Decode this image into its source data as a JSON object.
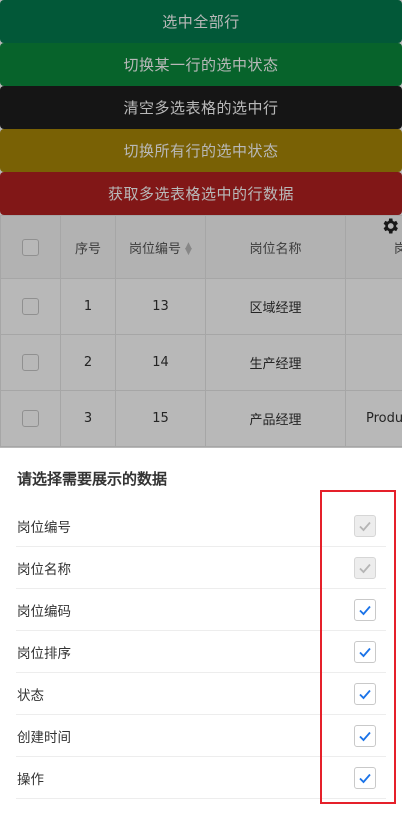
{
  "buttons": [
    {
      "label": "选中全部行",
      "color": "#037a4e"
    },
    {
      "label": "切换某一行的选中状态",
      "color": "#0a8a3c"
    },
    {
      "label": "清空多选表格的选中行",
      "color": "#1e1e1e"
    },
    {
      "label": "切换所有行的选中状态",
      "color": "#a88707"
    },
    {
      "label": "获取多选表格选中的行数据",
      "color": "#b32020"
    }
  ],
  "table": {
    "headers": {
      "index": "序号",
      "post_id": "岗位编号",
      "post_name": "岗位名称",
      "post_code_partial": "岗"
    },
    "rows": [
      {
        "index": "1",
        "post_id": "13",
        "post_name": "区域经理",
        "post_code": ""
      },
      {
        "index": "2",
        "post_id": "14",
        "post_name": "生产经理",
        "post_code": ""
      },
      {
        "index": "3",
        "post_id": "15",
        "post_name": "产品经理",
        "post_code": "Produ"
      }
    ]
  },
  "sheet": {
    "title": "请选择需要展示的数据",
    "columns": [
      {
        "label": "岗位编号",
        "checked": true,
        "disabled": true
      },
      {
        "label": "岗位名称",
        "checked": true,
        "disabled": true
      },
      {
        "label": "岗位编码",
        "checked": true,
        "disabled": false
      },
      {
        "label": "岗位排序",
        "checked": true,
        "disabled": false
      },
      {
        "label": "状态",
        "checked": true,
        "disabled": false
      },
      {
        "label": "创建时间",
        "checked": true,
        "disabled": false
      },
      {
        "label": "操作",
        "checked": true,
        "disabled": false
      }
    ]
  },
  "colors": {
    "check_active": "#1a73e8",
    "check_disabled": "#b5b5b5",
    "highlight": "#e5202a"
  },
  "icons": {
    "settings": "gear-icon",
    "sort": "sort-icon",
    "check": "check-icon"
  }
}
